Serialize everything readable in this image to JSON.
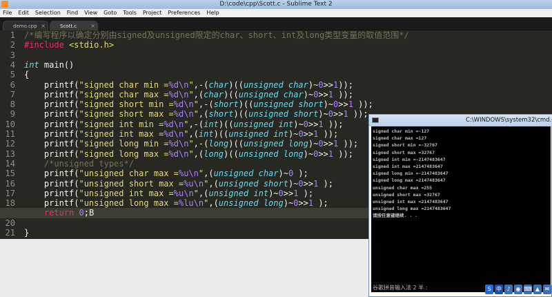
{
  "window": {
    "title": "D:\\code\\cpp\\Scott.c - Sublime Text 2"
  },
  "menu": [
    "File",
    "Edit",
    "Selection",
    "Find",
    "View",
    "Goto",
    "Tools",
    "Project",
    "Preferences",
    "Help"
  ],
  "tabs": [
    {
      "label": "demo.cpp",
      "close": "×"
    },
    {
      "label": "Scott.c",
      "close": "×"
    }
  ],
  "editor": {
    "line_numbers": [
      "1",
      "2",
      "3",
      "4",
      "5",
      "6",
      "7",
      "8",
      "9",
      "10",
      "11",
      "12",
      "13",
      "14",
      "15",
      "16",
      "17",
      "18",
      "19",
      "20",
      "21",
      "22"
    ],
    "current_line": 19
  },
  "cmd": {
    "title": "C:\\WINDOWS\\system32\\cmd.exe",
    "output": [
      "signed char min =-127",
      "signed char max =127",
      "signed short min =-32767",
      "signed short max =32767",
      "signed int min =-2147483647",
      "signed int max =2147483647",
      "signed long min =-2147483647",
      "signed long max =2147483647",
      "unsigned char max =255",
      "unsigned short max =32767",
      "unsigned int max =2147483647",
      "unsigned long max =2147483647",
      "请按任意键继续. . ."
    ],
    "ime_status": "谷歌拼音输入法 2 半 :"
  },
  "ime_tray": [
    "S",
    "中",
    "♪",
    "◉",
    "⌨",
    "▲",
    "✉"
  ],
  "watermark": "php"
}
